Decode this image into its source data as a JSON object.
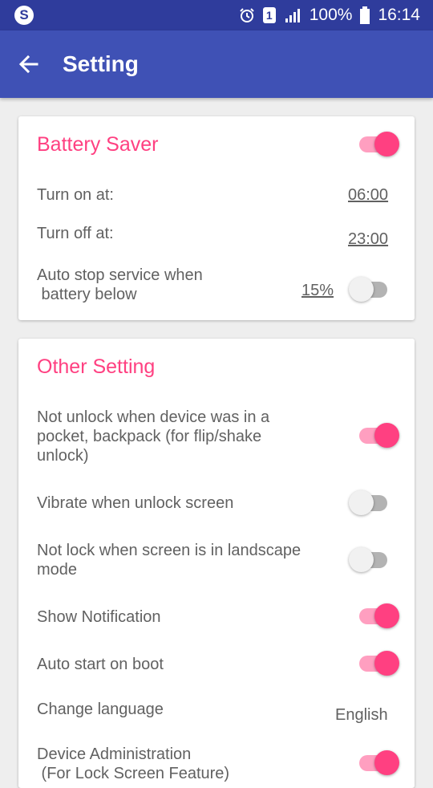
{
  "status_bar": {
    "battery": "100%",
    "time": "16:14",
    "sim": "1",
    "icons": [
      "skype-icon",
      "alarm-icon",
      "sim-icon",
      "signal-icon",
      "battery-icon"
    ]
  },
  "app_bar": {
    "title": "Setting",
    "back_icon": "arrow-back-icon"
  },
  "battery_saver": {
    "title": "Battery Saver",
    "enabled": true,
    "turn_on_label": "Turn on at:",
    "turn_on_time": "06:00",
    "turn_off_label": "Turn off at:",
    "turn_off_time": "23:00",
    "auto_stop_label_1": "Auto stop service when",
    "auto_stop_label_2": " battery below",
    "auto_stop_value": "15%",
    "auto_stop_enabled": false
  },
  "other_setting": {
    "title": "Other Setting",
    "pocket_line1": "Not unlock when device was in a",
    "pocket_line2": "pocket, backpack (for flip/shake",
    "pocket_line3": "unlock)",
    "pocket_enabled": true,
    "vibrate_label": "Vibrate when unlock screen",
    "vibrate_enabled": false,
    "landscape_line1": "Not lock when screen is in landscape",
    "landscape_line2": "mode",
    "landscape_enabled": false,
    "notification_label": "Show Notification",
    "notification_enabled": true,
    "autostart_label": "Auto start on boot",
    "autostart_enabled": true,
    "language_label": "Change language",
    "language_value": "English",
    "device_admin_line1": "Device Administration",
    "device_admin_line2": " (For Lock Screen Feature)",
    "device_admin_enabled": true
  },
  "colors": {
    "status_bar": "#2f3c9c",
    "app_bar": "#3f51b5",
    "accent": "#ff4081",
    "background": "#eeeeee"
  }
}
